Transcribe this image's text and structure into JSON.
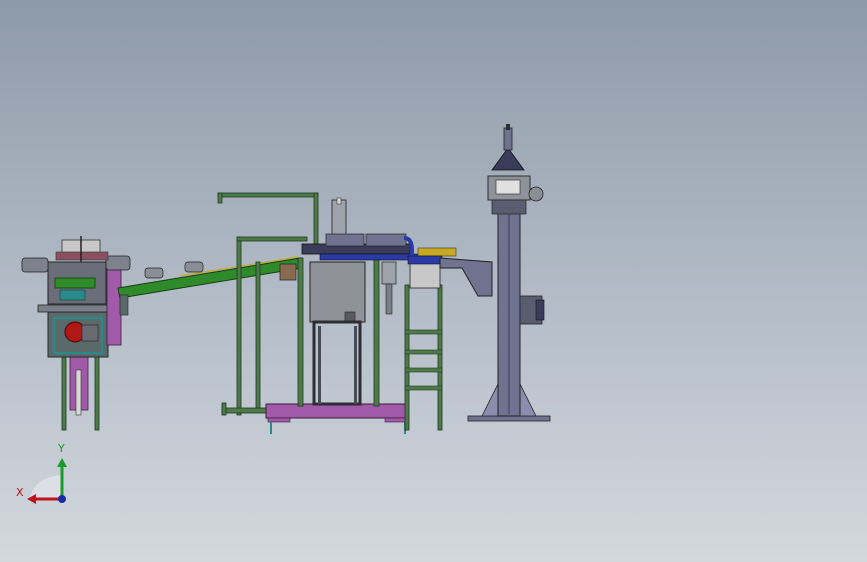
{
  "viewport": {
    "background_top": "#8d9aa8",
    "background_bottom": "#d3d8de"
  },
  "triad": {
    "x_label": "X",
    "y_label": "Y",
    "x_color": "#c0141a",
    "y_color": "#1a9a2a",
    "z_color": "#1a2aa8"
  },
  "colors": {
    "frame_green": "#4e7a4a",
    "frame_edge": "#1d3a1d",
    "conveyor_green": "#2f8a2a",
    "cabinet_gray": "#8f9399",
    "panel_dark": "#2c2c34",
    "base_purple": "#a05aa8",
    "tower_blue": "#6f7390",
    "tower_dark": "#3a3d5a",
    "accent_blue": "#2a3aa8",
    "accent_red": "#b01818",
    "accent_yellow": "#c8a820",
    "teal": "#2a8a8a"
  },
  "scene_parts": [
    "feeder-unit",
    "inclined-conveyor",
    "gantry-frame",
    "press-station",
    "ladder-frame",
    "column-tower"
  ]
}
